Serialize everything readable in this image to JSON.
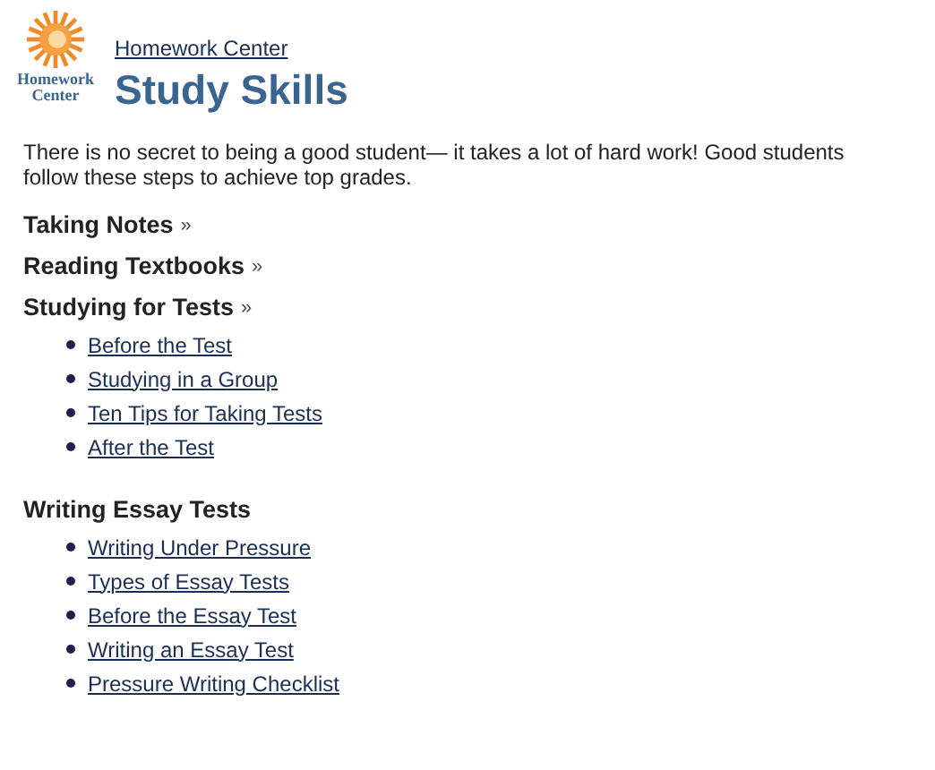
{
  "logo": {
    "text": "Homework Center"
  },
  "breadcrumb": "Homework Center",
  "title": "Study Skills",
  "intro": "There is no secret to being a good student— it takes a lot of hard work! Good students follow these steps to achieve top grades.",
  "sections": [
    {
      "title": "Taking Notes",
      "marker": "»"
    },
    {
      "title": "Reading Textbooks",
      "marker": "»"
    },
    {
      "title": "Studying for Tests",
      "marker": "»",
      "links": [
        "Before the Test",
        "Studying in a Group",
        "Ten Tips for Taking Tests",
        "After the Test"
      ]
    },
    {
      "title": "Writing Essay Tests",
      "links": [
        "Writing Under Pressure",
        "Types of Essay Tests",
        "Before the Essay Test",
        "Writing an Essay Test",
        "Pressure Writing Checklist"
      ]
    }
  ]
}
